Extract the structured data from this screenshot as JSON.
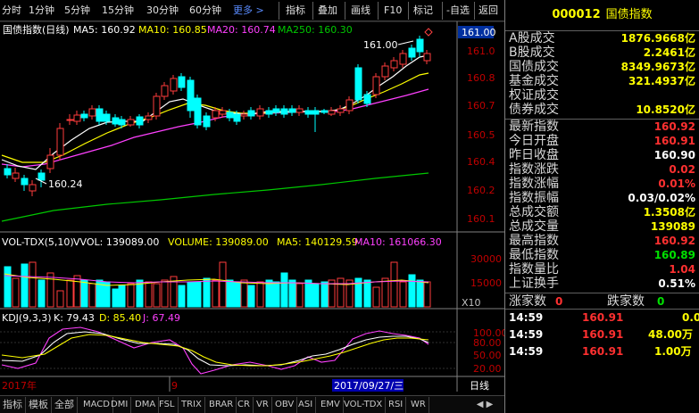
{
  "toolbar": {
    "periods": [
      "分时",
      "1分钟",
      "5分钟",
      "15分钟",
      "30分钟",
      "60分钟"
    ],
    "more": "更多 >",
    "tools": [
      "指标",
      "叠加",
      "画线",
      "F10",
      "标记",
      "-自选",
      "返回"
    ]
  },
  "kline": {
    "header_name": "国债指数(日线)",
    "ma5": "MA5: 160.92",
    "ma10": "MA10: 160.85",
    "ma20": "MA20: 160.74",
    "ma250": "MA250: 160.30",
    "high_label": "161.00",
    "low_label": "160.24",
    "current_price": "161.00",
    "y_ticks": [
      "161.0",
      "160.8",
      "160.7",
      "160.5",
      "160.4",
      "160.2",
      "160.1"
    ],
    "colors": {
      "up": "#ff3c3c",
      "down": "#00ffff",
      "ma5": "#ffffff",
      "ma10": "#ffff00",
      "ma20": "#ff40ff",
      "ma250": "#00c800"
    }
  },
  "volume": {
    "header": "VOL-TDX(5,10)",
    "vvol": "VVOL: 139089.00",
    "volume": "VOLUME: 139089.00",
    "ma5": "MA5: 140129.59",
    "ma10": "MA10: 161066.30",
    "y_ticks": [
      "30000",
      "15000"
    ],
    "unit": "X10"
  },
  "kdj": {
    "header": "KDJ(9,3,3)",
    "k": "K: 79.43",
    "d": "D: 85.40",
    "j": "J: 67.49",
    "y_ticks": [
      "100.00",
      "80.00",
      "50.00",
      "20.00"
    ]
  },
  "timeline": {
    "year": "2017年",
    "month": "9",
    "date_box": "2017/09/27/三",
    "period": "日线"
  },
  "tabs": [
    "指标",
    "模板",
    "全部",
    "MACD",
    "DMI",
    "DMA",
    "FSL",
    "TRIX",
    "BRAR",
    "CR",
    "VR",
    "OBV",
    "ASI",
    "EMV",
    "VOL-TDX",
    "RSI",
    "WR"
  ],
  "tabs_arrow": "◀ ▶",
  "panel": {
    "code": "000012",
    "name": "国债指数",
    "turnover": [
      {
        "label": "A股成交",
        "value": "1876.9668亿"
      },
      {
        "label": "B股成交",
        "value": "2.2461亿"
      },
      {
        "label": "国债成交",
        "value": "8349.9673亿"
      },
      {
        "label": "基金成交",
        "value": "321.4937亿"
      },
      {
        "label": "权证成交",
        "value": ""
      },
      {
        "label": "债券成交",
        "value": "10.8520亿"
      }
    ],
    "stats": [
      {
        "label": "最新指数",
        "value": "160.92",
        "color": "r"
      },
      {
        "label": "今日开盘",
        "value": "160.91",
        "color": "r"
      },
      {
        "label": "昨日收盘",
        "value": "160.90",
        "color": "w"
      },
      {
        "label": "指数涨跌",
        "value": "0.02",
        "color": "r"
      },
      {
        "label": "指数涨幅",
        "value": "0.01%",
        "color": "r"
      },
      {
        "label": "指数振幅",
        "value": "0.03/0.02%",
        "color": "w"
      },
      {
        "label": "总成交额",
        "value": "1.3508亿",
        "color": "y"
      },
      {
        "label": "总成交量",
        "value": "139089",
        "color": "y"
      },
      {
        "label": "最高指数",
        "value": "160.92",
        "color": "r"
      },
      {
        "label": "最低指数",
        "value": "160.89",
        "color": "g"
      },
      {
        "label": "指数量比",
        "value": "1.04",
        "color": "r"
      },
      {
        "label": "上证换手",
        "value": "0.51%",
        "color": "w"
      }
    ],
    "up_count_label": "涨家数",
    "down_count_label": "跌家数",
    "up_count": "0",
    "down_count": "0",
    "ticks": [
      {
        "time": "14:59",
        "price": "160.91",
        "vol": "0.0"
      },
      {
        "time": "14:59",
        "price": "160.91",
        "vol": "48.00万"
      },
      {
        "time": "14:59",
        "price": "160.91",
        "vol": "1.00万"
      }
    ]
  }
}
